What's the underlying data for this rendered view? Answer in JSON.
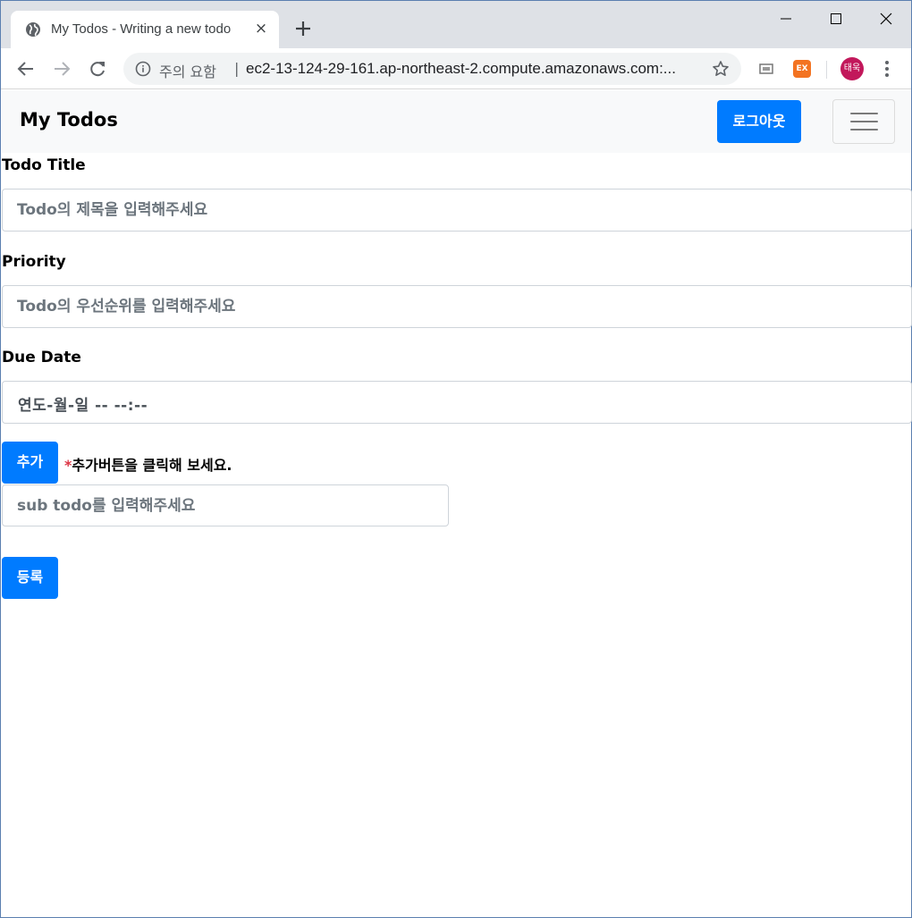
{
  "browser": {
    "tab_title": "My Todos - Writing a new todo",
    "tab_close": "×",
    "security_label": "주의 요함",
    "url": "ec2-13-124-29-161.ap-northeast-2.compute.amazonaws.com:...",
    "extension_label": "EX",
    "profile_initials": "태욱",
    "colors": {
      "tabstrip": "#dee1e6",
      "avatar": "#c2185b",
      "ext": "#f37321"
    }
  },
  "navbar": {
    "brand": "My Todos",
    "logout_label": "로그아웃"
  },
  "form": {
    "title_label": "Todo Title",
    "title_placeholder": "Todo의 제목을 입력해주세요",
    "priority_label": "Priority",
    "priority_placeholder": "Todo의 우선순위를 입력해주세요",
    "due_label": "Due Date",
    "due_placeholder": "연도-월-일 -- --:--",
    "add_label": "추가",
    "hint_star": "*",
    "hint_text": "추가버튼을 클릭해 보세요.",
    "sub_placeholder": "sub todo를 입력해주세요",
    "register_label": "등록"
  },
  "colors": {
    "primary": "#007bff",
    "navbar_bg": "#f8f9fa",
    "hint_star": "#dc3545"
  }
}
